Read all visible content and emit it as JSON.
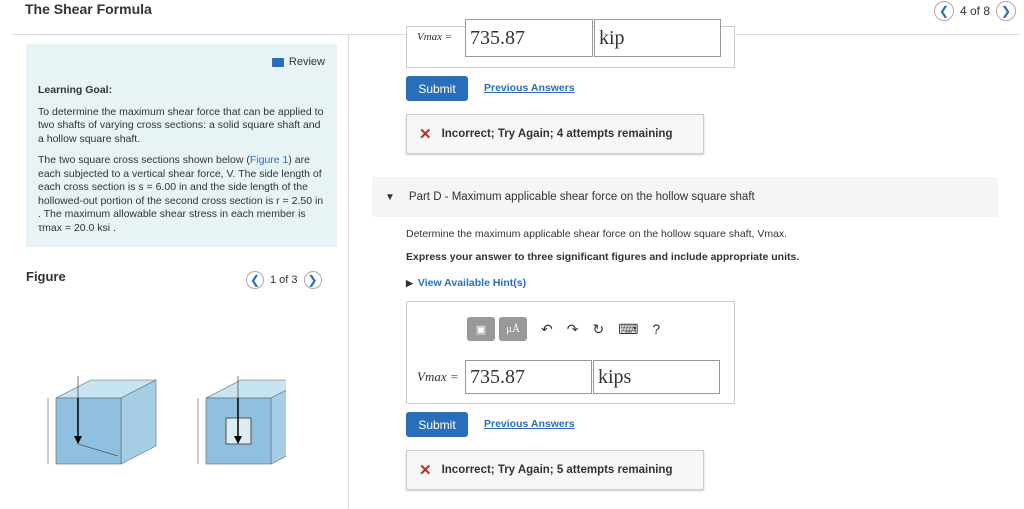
{
  "header": {
    "title": "The Shear Formula",
    "page_indicator": "4 of 8"
  },
  "learning_goal": {
    "review_label": "Review",
    "heading": "Learning Goal:",
    "intro": "To determine the maximum shear force that can be applied to two shafts of varying cross sections: a solid square shaft and a hollow square shaft.",
    "text_1": "The two square cross sections shown below (",
    "figure_link": "Figure 1",
    "text_2": ") are each subjected to a vertical shear force, V. The side length of each cross section is s = 6.00 in and the side length of the hollowed-out portion of the second cross section is r = 2.50 in . The maximum allowable shear stress in each member is τmax = 20.0 ksi ."
  },
  "figure": {
    "label": "Figure",
    "page": "1 of 3"
  },
  "part_c": {
    "var_label": "Vmax =",
    "value": "735.87",
    "unit": "kip",
    "submit_label": "Submit",
    "previous_answers": "Previous Answers",
    "feedback": "Incorrect; Try Again; 4 attempts remaining"
  },
  "part_d": {
    "title": "Part D - Maximum applicable shear force on the hollow square shaft",
    "question": "Determine the maximum applicable shear force on the hollow square shaft, Vmax.",
    "instructions": "Express your answer to three significant figures and include appropriate units.",
    "hints": "View Available Hint(s)",
    "toolbar": {
      "units_btn": "μÅ",
      "help": "?"
    },
    "var_label": "Vmax =",
    "value": "735.87",
    "unit": "kips",
    "submit_label": "Submit",
    "previous_answers": "Previous Answers",
    "feedback": "Incorrect; Try Again; 5 attempts remaining"
  },
  "colors": {
    "accent": "#2a6ebb",
    "error": "#d0271d",
    "goal_bg": "#e8f3f6"
  }
}
